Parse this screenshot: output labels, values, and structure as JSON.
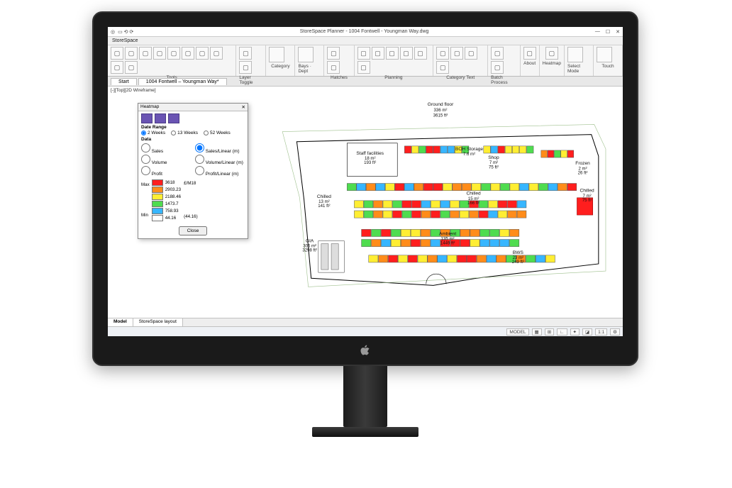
{
  "window": {
    "title": "StoreSpace Planner - 1004 Fontwell - Youngman Way.dwg",
    "min": "—",
    "max": "☐",
    "close": "✕",
    "menu_item": "StoreSpace"
  },
  "ribbon": {
    "groups": [
      {
        "id": "tools",
        "label": "Tools",
        "icons": 10
      },
      {
        "id": "layer-toggle",
        "label": "Layer Toggle",
        "icons": 2
      },
      {
        "id": "category",
        "label": "Category",
        "big": true
      },
      {
        "id": "bays-dept",
        "label": "Bays · Dept",
        "big": true
      },
      {
        "id": "hatches",
        "label": "Hatches",
        "icons": 2
      },
      {
        "id": "planning",
        "label": "Planning",
        "icons": 6
      },
      {
        "id": "category-text",
        "label": "Category Text",
        "icons": 4
      },
      {
        "id": "batch-process",
        "label": "Batch Process",
        "icons": 2
      },
      {
        "id": "about",
        "label": "About",
        "icons": 1
      },
      {
        "id": "heatmap",
        "label": "Heatmap",
        "icons": 1
      },
      {
        "id": "select-mode",
        "label": "Select Mode",
        "big": true
      },
      {
        "id": "touch",
        "label": "Touch",
        "big": true
      }
    ]
  },
  "doctabs": {
    "start": "Start",
    "active": "1004 Fontwell – Youngman Way*"
  },
  "path_line": "[-][Top][2D Wireframe]",
  "heatmap_dialog": {
    "title": "Heatmap",
    "date_range_label": "Date Range",
    "date_opts": [
      "2 Weeks",
      "13 Weeks",
      "52 Weeks"
    ],
    "date_selected": "2 Weeks",
    "data_label": "Data",
    "metric_opts_left": [
      "Sales",
      "Volume",
      "Profit"
    ],
    "metric_opts_right": [
      "Sales/Linear (m)",
      "Volume/Linear (m)",
      "Profit/Linear (m)"
    ],
    "metric_selected": "Sales/Linear (m)",
    "unit_label": "£/M18",
    "legend_max": "Max",
    "legend_min": "Min",
    "legend": [
      {
        "color": "#ff1e1e",
        "value": "3618"
      },
      {
        "color": "#ff8c1a",
        "value": "2903.23"
      },
      {
        "color": "#ffee33",
        "value": "2188.46"
      },
      {
        "color": "#4fdc4f",
        "value": "1473.7"
      },
      {
        "color": "#37b6ff",
        "value": "758.93"
      },
      {
        "color": "#ffffff",
        "value": "44.16"
      }
    ],
    "legend_low_note": "(44.16)",
    "close": "Close"
  },
  "floorplan": {
    "title": "Ground floor",
    "area_m": "336 m²",
    "area_ft": "3615 ft²",
    "rooms": [
      {
        "id": "staff",
        "name": "Staff facilities",
        "m": "18 m²",
        "ft": "193 ft²"
      },
      {
        "id": "boh",
        "name": "BOH Storage",
        "m": "7.6 m²",
        "ft": ""
      },
      {
        "id": "shop",
        "name": "Shop",
        "m": "7 m²",
        "ft": "75 ft²"
      },
      {
        "id": "frozen",
        "name": "Frozen",
        "m": "2 m²",
        "ft": "26 ft²"
      },
      {
        "id": "chilledL",
        "name": "Chilled",
        "m": "13 m²",
        "ft": "141 ft²"
      },
      {
        "id": "chilledC",
        "name": "Chilled",
        "m": "15 m²",
        "ft": "166 ft²"
      },
      {
        "id": "chilledR",
        "name": "Chilled",
        "m": "7 m²",
        "ft": "75 ft²"
      },
      {
        "id": "ambient",
        "name": "Ambient",
        "m": "135 m²",
        "ft": "1449 ft²"
      },
      {
        "id": "gia",
        "name": "GIA",
        "m": "306 m²",
        "ft": "3298 ft²"
      },
      {
        "id": "bws",
        "name": "BWS",
        "m": "23 m²",
        "ft": "249 ft²"
      }
    ]
  },
  "bottom_tabs": {
    "model": "Model",
    "layout": "StoreSpace layout"
  },
  "statusbar": {
    "mode": "MODEL"
  }
}
